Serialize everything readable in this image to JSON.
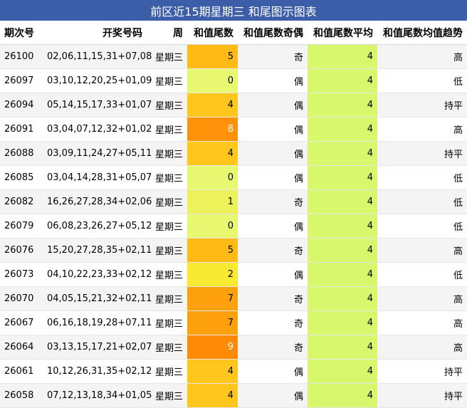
{
  "title": "前区近15期星期三 和尾图示图表",
  "columns": [
    "期次号",
    "开奖号码",
    "周",
    "和值尾数",
    "和值尾数奇偶",
    "和值尾数平均",
    "和值尾数均值趋势"
  ],
  "colors": {
    "header_bg": "#3c5ea8",
    "avg_bg": "#d9f76d",
    "sum_scale": {
      "0": "#e8f870",
      "1": "#eef25a",
      "2": "#f8ea32",
      "4": "#ffc61e",
      "5": "#ffba16",
      "7": "#ffa10e",
      "8": "#ff9208",
      "9": "#ff8a06"
    }
  },
  "rows": [
    {
      "issue": "26100",
      "numbers": "02,06,11,15,31+07,08",
      "weekday": "星期三",
      "sum_tail": "5",
      "parity": "奇",
      "avg": "4",
      "trend": "高"
    },
    {
      "issue": "26097",
      "numbers": "03,10,12,20,25+01,09",
      "weekday": "星期三",
      "sum_tail": "0",
      "parity": "偶",
      "avg": "4",
      "trend": "低"
    },
    {
      "issue": "26094",
      "numbers": "05,14,15,17,33+01,07",
      "weekday": "星期三",
      "sum_tail": "4",
      "parity": "偶",
      "avg": "4",
      "trend": "持平"
    },
    {
      "issue": "26091",
      "numbers": "03,04,07,12,32+01,02",
      "weekday": "星期三",
      "sum_tail": "8",
      "parity": "偶",
      "avg": "4",
      "trend": "高"
    },
    {
      "issue": "26088",
      "numbers": "03,09,11,24,27+05,11",
      "weekday": "星期三",
      "sum_tail": "4",
      "parity": "偶",
      "avg": "4",
      "trend": "持平"
    },
    {
      "issue": "26085",
      "numbers": "03,04,14,28,31+05,07",
      "weekday": "星期三",
      "sum_tail": "0",
      "parity": "偶",
      "avg": "4",
      "trend": "低"
    },
    {
      "issue": "26082",
      "numbers": "16,26,27,28,34+02,06",
      "weekday": "星期三",
      "sum_tail": "1",
      "parity": "奇",
      "avg": "4",
      "trend": "低"
    },
    {
      "issue": "26079",
      "numbers": "06,08,23,26,27+05,12",
      "weekday": "星期三",
      "sum_tail": "0",
      "parity": "偶",
      "avg": "4",
      "trend": "低"
    },
    {
      "issue": "26076",
      "numbers": "15,20,27,28,35+02,11",
      "weekday": "星期三",
      "sum_tail": "5",
      "parity": "奇",
      "avg": "4",
      "trend": "高"
    },
    {
      "issue": "26073",
      "numbers": "04,10,22,23,33+02,12",
      "weekday": "星期三",
      "sum_tail": "2",
      "parity": "偶",
      "avg": "4",
      "trend": "低"
    },
    {
      "issue": "26070",
      "numbers": "04,05,15,21,32+02,11",
      "weekday": "星期三",
      "sum_tail": "7",
      "parity": "奇",
      "avg": "4",
      "trend": "高"
    },
    {
      "issue": "26067",
      "numbers": "06,16,18,19,28+07,11",
      "weekday": "星期三",
      "sum_tail": "7",
      "parity": "奇",
      "avg": "4",
      "trend": "高"
    },
    {
      "issue": "26064",
      "numbers": "03,13,15,17,21+02,07",
      "weekday": "星期三",
      "sum_tail": "9",
      "parity": "奇",
      "avg": "4",
      "trend": "高"
    },
    {
      "issue": "26061",
      "numbers": "10,12,26,31,35+02,12",
      "weekday": "星期三",
      "sum_tail": "4",
      "parity": "偶",
      "avg": "4",
      "trend": "持平"
    },
    {
      "issue": "26058",
      "numbers": "07,12,13,18,34+01,05",
      "weekday": "星期三",
      "sum_tail": "4",
      "parity": "偶",
      "avg": "4",
      "trend": "持平"
    }
  ]
}
